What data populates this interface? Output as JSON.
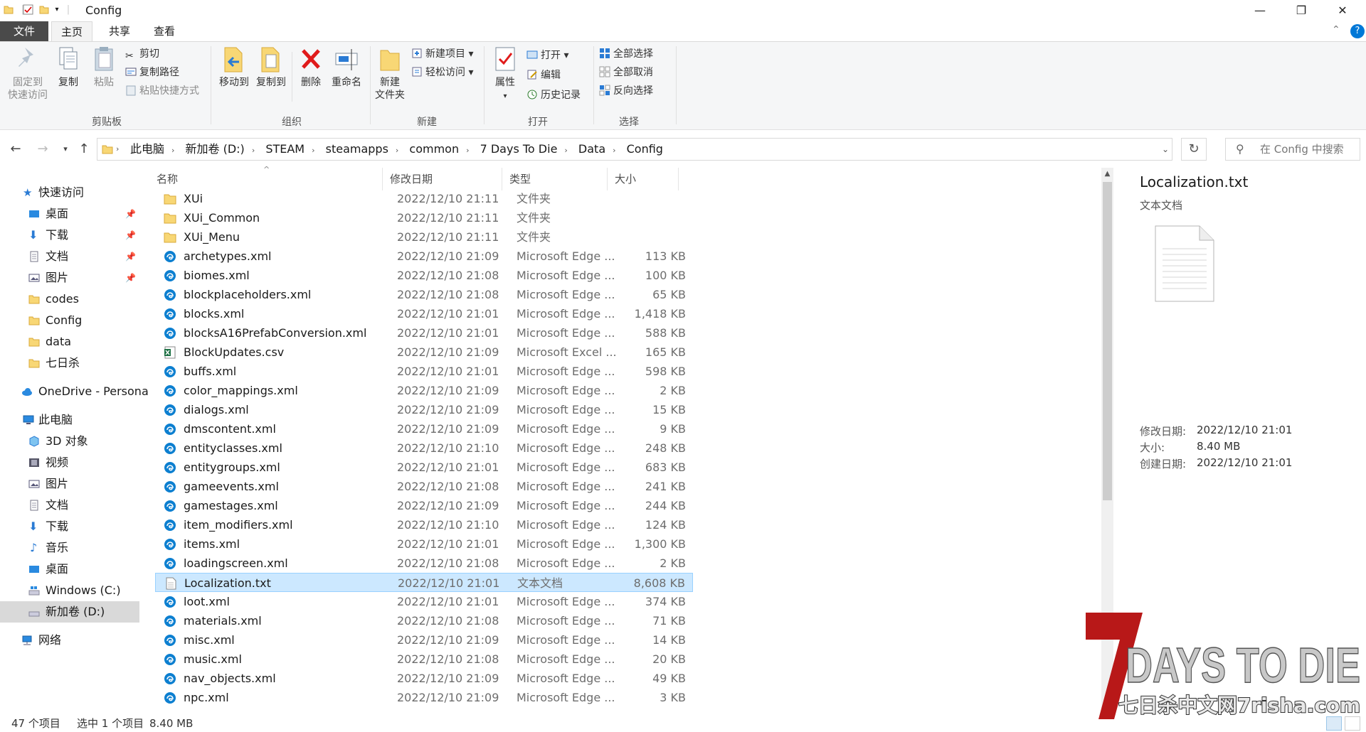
{
  "window": {
    "title": "Config",
    "minimize": "—",
    "maximize": "❐",
    "close": "✕"
  },
  "ribbon_tabs": [
    {
      "label": "文件"
    },
    {
      "label": "主页"
    },
    {
      "label": "共享"
    },
    {
      "label": "查看"
    }
  ],
  "ribbon": {
    "clipboard": {
      "pin_label_1": "固定到",
      "pin_label_2": "快速访问",
      "copy": "复制",
      "paste": "粘贴",
      "cut": "剪切",
      "copy_path": "复制路径",
      "paste_shortcut": "粘贴快捷方式",
      "group": "剪贴板"
    },
    "organize": {
      "move_to": "移动到",
      "copy_to": "复制到",
      "delete": "删除",
      "rename": "重命名",
      "group": "组织"
    },
    "new": {
      "new_folder_1": "新建",
      "new_folder_2": "文件夹",
      "new_item": "新建项目",
      "easy_access": "轻松访问",
      "group": "新建"
    },
    "open": {
      "properties": "属性",
      "open": "打开",
      "edit": "编辑",
      "history": "历史记录",
      "group": "打开"
    },
    "select": {
      "select_all": "全部选择",
      "select_none": "全部取消",
      "invert": "反向选择",
      "group": "选择"
    }
  },
  "address": {
    "crumbs": [
      "此电脑",
      "新加卷 (D:)",
      "STEAM",
      "steamapps",
      "common",
      "7 Days To Die",
      "Data",
      "Config"
    ],
    "search_placeholder": "在 Config 中搜索"
  },
  "nav": {
    "quick_access": "快速访问",
    "quick_items": [
      {
        "label": "桌面",
        "pinned": true
      },
      {
        "label": "下载",
        "pinned": true
      },
      {
        "label": "文档",
        "pinned": true
      },
      {
        "label": "图片",
        "pinned": true
      },
      {
        "label": "codes",
        "pinned": false
      },
      {
        "label": "Config",
        "pinned": false
      },
      {
        "label": "data",
        "pinned": false
      },
      {
        "label": "七日杀",
        "pinned": false
      }
    ],
    "onedrive": "OneDrive - Persona",
    "this_pc": "此电脑",
    "pc_items": [
      {
        "label": "3D 对象"
      },
      {
        "label": "视频"
      },
      {
        "label": "图片"
      },
      {
        "label": "文档"
      },
      {
        "label": "下载"
      },
      {
        "label": "音乐"
      },
      {
        "label": "桌面"
      },
      {
        "label": "Windows (C:)"
      },
      {
        "label": "新加卷 (D:)"
      }
    ],
    "network": "网络"
  },
  "columns": {
    "name": "名称",
    "date": "修改日期",
    "type": "类型",
    "size": "大小"
  },
  "files": [
    {
      "name": "XUi",
      "date": "2022/12/10 21:11",
      "type": "文件夹",
      "size": "",
      "kind": "folder"
    },
    {
      "name": "XUi_Common",
      "date": "2022/12/10 21:11",
      "type": "文件夹",
      "size": "",
      "kind": "folder"
    },
    {
      "name": "XUi_Menu",
      "date": "2022/12/10 21:11",
      "type": "文件夹",
      "size": "",
      "kind": "folder"
    },
    {
      "name": "archetypes.xml",
      "date": "2022/12/10 21:09",
      "type": "Microsoft Edge ...",
      "size": "113 KB",
      "kind": "edge"
    },
    {
      "name": "biomes.xml",
      "date": "2022/12/10 21:08",
      "type": "Microsoft Edge ...",
      "size": "100 KB",
      "kind": "edge"
    },
    {
      "name": "blockplaceholders.xml",
      "date": "2022/12/10 21:08",
      "type": "Microsoft Edge ...",
      "size": "65 KB",
      "kind": "edge"
    },
    {
      "name": "blocks.xml",
      "date": "2022/12/10 21:01",
      "type": "Microsoft Edge ...",
      "size": "1,418 KB",
      "kind": "edge"
    },
    {
      "name": "blocksA16PrefabConversion.xml",
      "date": "2022/12/10 21:01",
      "type": "Microsoft Edge ...",
      "size": "588 KB",
      "kind": "edge"
    },
    {
      "name": "BlockUpdates.csv",
      "date": "2022/12/10 21:09",
      "type": "Microsoft Excel ...",
      "size": "165 KB",
      "kind": "excel"
    },
    {
      "name": "buffs.xml",
      "date": "2022/12/10 21:01",
      "type": "Microsoft Edge ...",
      "size": "598 KB",
      "kind": "edge"
    },
    {
      "name": "color_mappings.xml",
      "date": "2022/12/10 21:09",
      "type": "Microsoft Edge ...",
      "size": "2 KB",
      "kind": "edge"
    },
    {
      "name": "dialogs.xml",
      "date": "2022/12/10 21:09",
      "type": "Microsoft Edge ...",
      "size": "15 KB",
      "kind": "edge"
    },
    {
      "name": "dmscontent.xml",
      "date": "2022/12/10 21:09",
      "type": "Microsoft Edge ...",
      "size": "9 KB",
      "kind": "edge"
    },
    {
      "name": "entityclasses.xml",
      "date": "2022/12/10 21:10",
      "type": "Microsoft Edge ...",
      "size": "248 KB",
      "kind": "edge"
    },
    {
      "name": "entitygroups.xml",
      "date": "2022/12/10 21:01",
      "type": "Microsoft Edge ...",
      "size": "683 KB",
      "kind": "edge"
    },
    {
      "name": "gameevents.xml",
      "date": "2022/12/10 21:08",
      "type": "Microsoft Edge ...",
      "size": "241 KB",
      "kind": "edge"
    },
    {
      "name": "gamestages.xml",
      "date": "2022/12/10 21:09",
      "type": "Microsoft Edge ...",
      "size": "244 KB",
      "kind": "edge"
    },
    {
      "name": "item_modifiers.xml",
      "date": "2022/12/10 21:10",
      "type": "Microsoft Edge ...",
      "size": "124 KB",
      "kind": "edge"
    },
    {
      "name": "items.xml",
      "date": "2022/12/10 21:01",
      "type": "Microsoft Edge ...",
      "size": "1,300 KB",
      "kind": "edge"
    },
    {
      "name": "loadingscreen.xml",
      "date": "2022/12/10 21:08",
      "type": "Microsoft Edge ...",
      "size": "2 KB",
      "kind": "edge"
    },
    {
      "name": "Localization.txt",
      "date": "2022/12/10 21:01",
      "type": "文本文档",
      "size": "8,608 KB",
      "kind": "text",
      "selected": true
    },
    {
      "name": "loot.xml",
      "date": "2022/12/10 21:01",
      "type": "Microsoft Edge ...",
      "size": "374 KB",
      "kind": "edge"
    },
    {
      "name": "materials.xml",
      "date": "2022/12/10 21:08",
      "type": "Microsoft Edge ...",
      "size": "71 KB",
      "kind": "edge"
    },
    {
      "name": "misc.xml",
      "date": "2022/12/10 21:09",
      "type": "Microsoft Edge ...",
      "size": "14 KB",
      "kind": "edge"
    },
    {
      "name": "music.xml",
      "date": "2022/12/10 21:08",
      "type": "Microsoft Edge ...",
      "size": "20 KB",
      "kind": "edge"
    },
    {
      "name": "nav_objects.xml",
      "date": "2022/12/10 21:09",
      "type": "Microsoft Edge ...",
      "size": "49 KB",
      "kind": "edge"
    },
    {
      "name": "npc.xml",
      "date": "2022/12/10 21:09",
      "type": "Microsoft Edge ...",
      "size": "3 KB",
      "kind": "edge"
    }
  ],
  "details": {
    "title": "Localization.txt",
    "type": "文本文档",
    "props": [
      {
        "label": "修改日期:",
        "value": "2022/12/10 21:01"
      },
      {
        "label": "大小:",
        "value": "8.40 MB"
      },
      {
        "label": "创建日期:",
        "value": "2022/12/10 21:01"
      }
    ]
  },
  "status": {
    "count": "47 个项目",
    "selected": "选中 1 个项目",
    "size": "8.40 MB"
  },
  "watermark": {
    "line1": "7DAYS TO DIE",
    "line2": "七日杀中文网7risha.com"
  },
  "colors": {
    "selection_bg": "#cce8ff",
    "accent": "#0078d7",
    "folder": "#f8d775",
    "edge": "#0c7fd0",
    "excel": "#1d7044"
  }
}
